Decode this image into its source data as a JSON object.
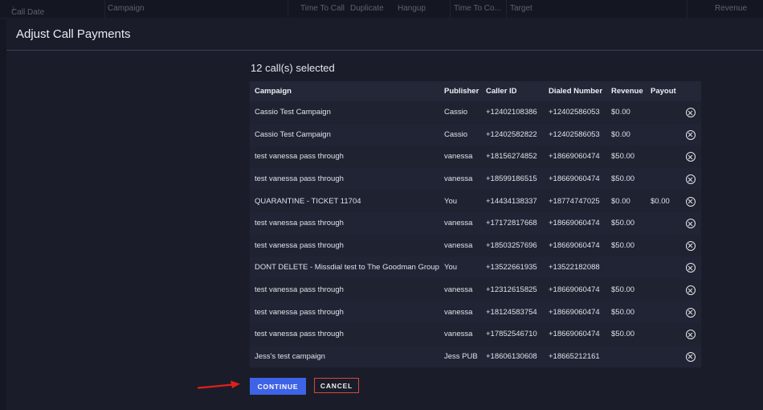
{
  "background_header": {
    "columns": [
      "Call Date",
      "Campaign",
      "Time To Call",
      "Duplicate",
      "Hangup",
      "Time To Co...",
      "Target",
      "Revenue"
    ]
  },
  "modal": {
    "title": "Adjust Call Payments",
    "selected_text": "12 call(s) selected",
    "columns": [
      "Campaign",
      "Publisher",
      "Caller ID",
      "Dialed Number",
      "Revenue",
      "Payout"
    ],
    "rows": [
      {
        "campaign": "Cassio Test Campaign",
        "publisher": "Cassio",
        "caller_id": "+12402108386",
        "dialed": "+12402586053",
        "revenue": "$0.00",
        "payout": ""
      },
      {
        "campaign": "Cassio Test Campaign",
        "publisher": "Cassio",
        "caller_id": "+12402582822",
        "dialed": "+12402586053",
        "revenue": "$0.00",
        "payout": ""
      },
      {
        "campaign": "test vanessa pass through",
        "publisher": "vanessa",
        "caller_id": "+18156274852",
        "dialed": "+18669060474",
        "revenue": "$50.00",
        "payout": ""
      },
      {
        "campaign": "test vanessa pass through",
        "publisher": "vanessa",
        "caller_id": "+18599186515",
        "dialed": "+18669060474",
        "revenue": "$50.00",
        "payout": ""
      },
      {
        "campaign": "QUARANTINE - TICKET 11704",
        "publisher": "You",
        "caller_id": "+14434138337",
        "dialed": "+18774747025",
        "revenue": "$0.00",
        "payout": "$0.00"
      },
      {
        "campaign": "test vanessa pass through",
        "publisher": "vanessa",
        "caller_id": "+17172817668",
        "dialed": "+18669060474",
        "revenue": "$50.00",
        "payout": ""
      },
      {
        "campaign": "test vanessa pass through",
        "publisher": "vanessa",
        "caller_id": "+18503257696",
        "dialed": "+18669060474",
        "revenue": "$50.00",
        "payout": ""
      },
      {
        "campaign": "DONT DELETE - Missdial test to The Goodman Group",
        "publisher": "You",
        "caller_id": "+13522661935",
        "dialed": "+13522182088",
        "revenue": "",
        "payout": ""
      },
      {
        "campaign": "test vanessa pass through",
        "publisher": "vanessa",
        "caller_id": "+12312615825",
        "dialed": "+18669060474",
        "revenue": "$50.00",
        "payout": ""
      },
      {
        "campaign": "test vanessa pass through",
        "publisher": "vanessa",
        "caller_id": "+18124583754",
        "dialed": "+18669060474",
        "revenue": "$50.00",
        "payout": ""
      },
      {
        "campaign": "test vanessa pass through",
        "publisher": "vanessa",
        "caller_id": "+17852546710",
        "dialed": "+18669060474",
        "revenue": "$50.00",
        "payout": ""
      },
      {
        "campaign": "Jess's test campaign",
        "publisher": "Jess PUB",
        "caller_id": "+18606130608",
        "dialed": "+18665212161",
        "revenue": "",
        "payout": ""
      }
    ],
    "continue_label": "CONTINUE",
    "cancel_label": "CANCEL"
  },
  "colors": {
    "accent": "#3f63e6",
    "cancel_border": "#d9463f",
    "annotation_arrow": "#e0201c"
  },
  "icons": {
    "sort": "arrow-down-icon",
    "remove_row": "remove-circle-x-icon",
    "annotation": "red-arrow-icon"
  }
}
